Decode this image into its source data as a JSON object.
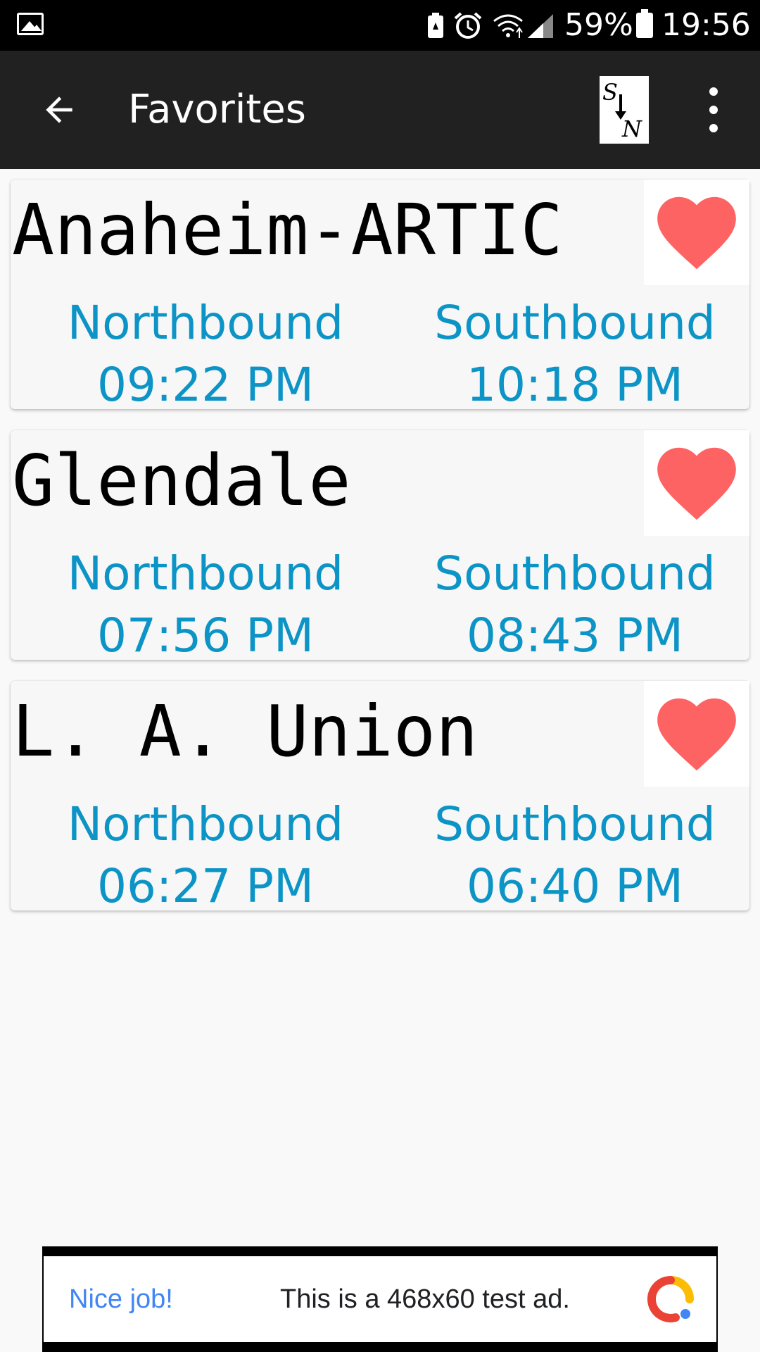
{
  "status_bar": {
    "battery_percent": "59%",
    "time": "19:56",
    "icons": [
      "gallery-icon",
      "battery-saver-icon",
      "alarm-icon",
      "wifi-icon",
      "cell-signal-icon",
      "battery-icon"
    ]
  },
  "app_bar": {
    "title": "Favorites",
    "back_icon": "arrow-back-icon",
    "logo_icon": "south-north-logo-icon",
    "menu_icon": "more-vert-icon"
  },
  "stations": [
    {
      "name": "Anaheim-ARTIC",
      "favorite": true,
      "northbound_label": "Northbound",
      "northbound_time": "09:22 PM",
      "southbound_label": "Southbound",
      "southbound_time": "10:18 PM"
    },
    {
      "name": "Glendale",
      "favorite": true,
      "northbound_label": "Northbound",
      "northbound_time": "07:56 PM",
      "southbound_label": "Southbound",
      "southbound_time": "08:43 PM"
    },
    {
      "name": "L. A. Union",
      "favorite": true,
      "northbound_label": "Northbound",
      "northbound_time": "06:27 PM",
      "southbound_label": "Southbound",
      "southbound_time": "06:40 PM"
    }
  ],
  "ad": {
    "headline": "Nice job!",
    "text": "This is a 468x60 test ad."
  },
  "colors": {
    "accent": "#0d94c6",
    "heart": "#fe6363",
    "app_bar": "#212121",
    "status_bar": "#000000",
    "background": "#f9f9f9"
  }
}
